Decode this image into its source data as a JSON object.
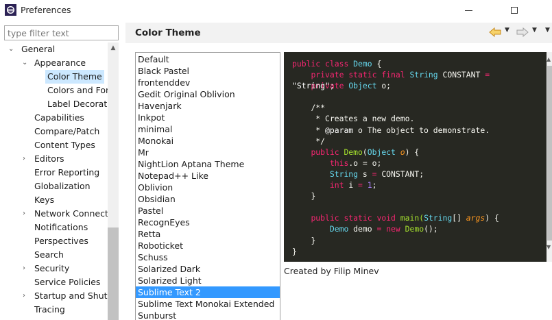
{
  "window": {
    "title": "Preferences"
  },
  "filter": {
    "placeholder": "type filter text"
  },
  "tree": {
    "items": [
      {
        "label": "General",
        "twisty": "expanded"
      },
      {
        "label": "Appearance",
        "twisty": "expanded"
      },
      {
        "label": "Color Theme",
        "twisty": "none"
      },
      {
        "label": "Colors and Fonts",
        "twisty": "none"
      },
      {
        "label": "Label Decorations",
        "twisty": "none"
      },
      {
        "label": "Capabilities",
        "twisty": "none"
      },
      {
        "label": "Compare/Patch",
        "twisty": "none"
      },
      {
        "label": "Content Types",
        "twisty": "none"
      },
      {
        "label": "Editors",
        "twisty": "collapsed"
      },
      {
        "label": "Error Reporting",
        "twisty": "none"
      },
      {
        "label": "Globalization",
        "twisty": "none"
      },
      {
        "label": "Keys",
        "twisty": "none"
      },
      {
        "label": "Network Connections",
        "twisty": "collapsed"
      },
      {
        "label": "Notifications",
        "twisty": "none"
      },
      {
        "label": "Perspectives",
        "twisty": "none"
      },
      {
        "label": "Search",
        "twisty": "none"
      },
      {
        "label": "Security",
        "twisty": "collapsed"
      },
      {
        "label": "Service Policies",
        "twisty": "none"
      },
      {
        "label": "Startup and Shutdown",
        "twisty": "collapsed"
      },
      {
        "label": "Tracing",
        "twisty": "none"
      }
    ],
    "selected": "Color Theme"
  },
  "page": {
    "title": "Color Theme",
    "credits": "Created by Filip Minev"
  },
  "themes": {
    "items": [
      "Default",
      "Black Pastel",
      "frontenddev",
      "Gedit Original Oblivion",
      "Havenjark",
      "Inkpot",
      "minimal",
      "Monokai",
      "Mr",
      "NightLion Aptana Theme",
      "Notepad++ Like",
      "Oblivion",
      "Obsidian",
      "Pastel",
      "RecognEyes",
      "Retta",
      "Roboticket",
      "Schuss",
      "Solarized Dark",
      "Solarized Light",
      "Sublime Text 2",
      "Sublime Text Monokai Extended",
      "Sunburst"
    ],
    "selected": "Sublime Text 2"
  },
  "preview": {
    "overlay_string": "\"String\";",
    "lines": {
      "l1_kw1": "public",
      "l1_kw2": "class",
      "l1_cls": "Demo",
      "l1_brace": " {",
      "l2_kw1": "private",
      "l2_kw2": "static",
      "l2_kw3": "final",
      "l2_type": "String",
      "l2_name": "CONSTANT",
      "l2_eq": "=",
      "l3_kw": "private",
      "l3_type": "Object",
      "l3_name": "o;",
      "l5": "/**",
      "l6": " * Creates a new demo.",
      "l7_tag": "@param",
      "l7_rest": " o The object to demonstrate.",
      "l8": " */",
      "l9_kw": "public",
      "l9_cls": "Demo",
      "l9_open": "(",
      "l9_type": "Object",
      "l9_arg": "o",
      "l9_close": ") {",
      "l10_kw": "this",
      "l10_rest": ".o = o;",
      "l11_type": "String",
      "l11_var": "s",
      "l11_eq": "=",
      "l11_rest": "CONSTANT;",
      "l12_type": "int",
      "l12_var": "i",
      "l12_eq": "=",
      "l12_num": "1",
      "l12_semi": ";",
      "l13": "}",
      "l15_kw1": "public",
      "l15_kw2": "static",
      "l15_kw3": "void",
      "l15_name": "main(",
      "l15_type": "String",
      "l15_br": "[]",
      "l15_arg": "args",
      "l15_close": ") {",
      "l16_cls": "Demo",
      "l16_var": "demo",
      "l16_eq": "=",
      "l16_kw": "new",
      "l16_cls2": "Demo",
      "l16_rest": "();",
      "l17": "}",
      "l18": "}"
    }
  },
  "colors": {
    "selection": "#3399ff",
    "tree_selection": "#cce8ff",
    "editor_bg": "#272822",
    "keyword": "#f92672",
    "type": "#66d9ef",
    "class": "#a6e22e",
    "string": "#e6db74",
    "number": "#ae81ff"
  }
}
